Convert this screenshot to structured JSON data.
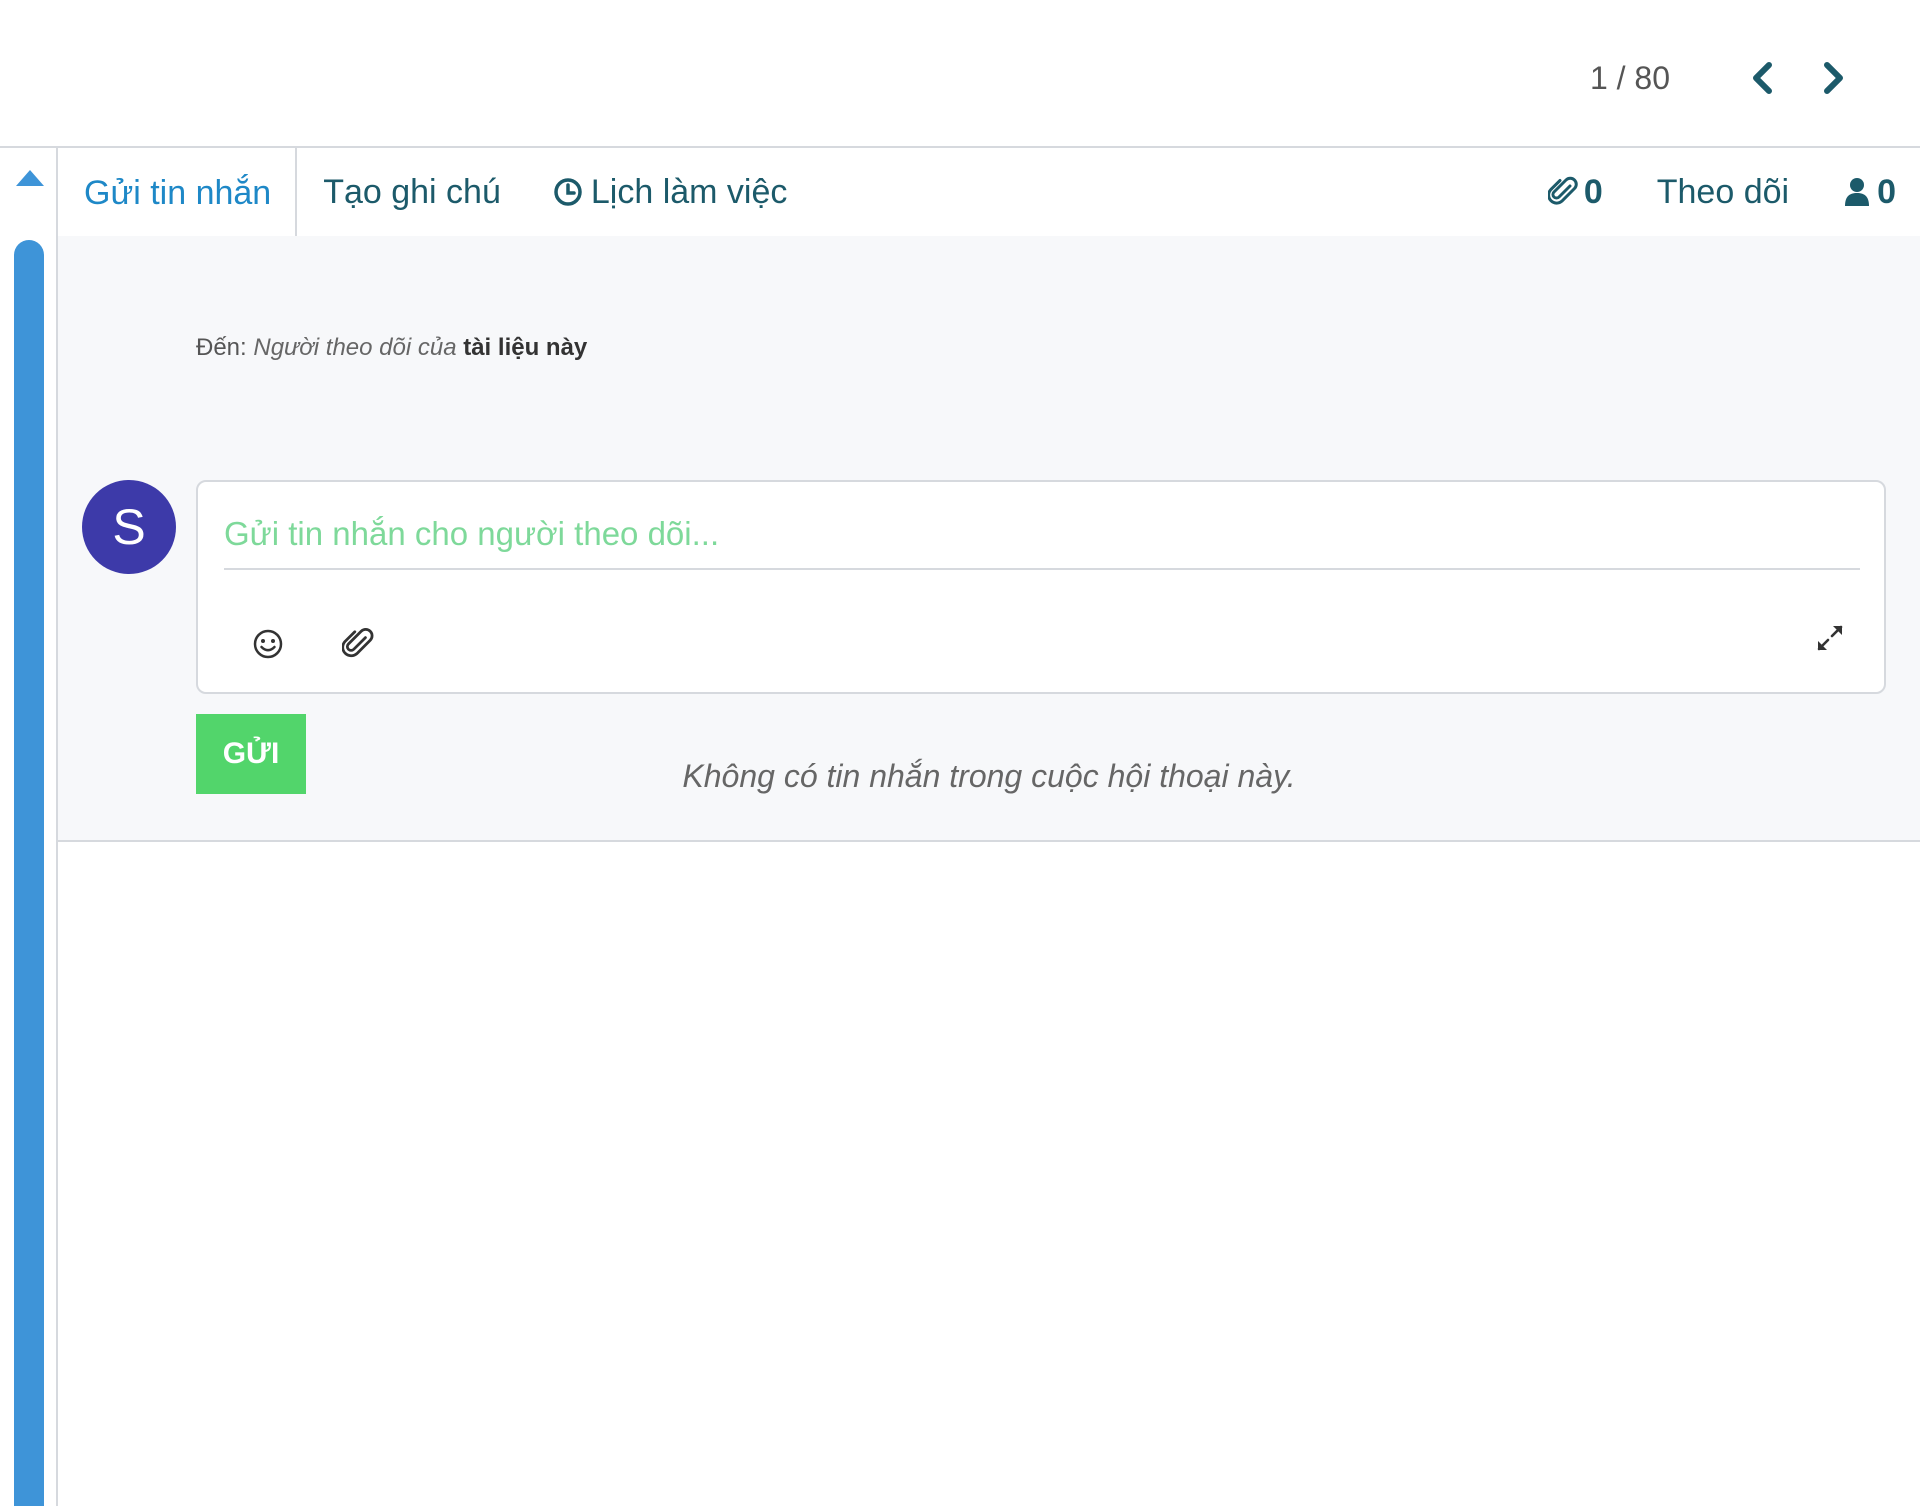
{
  "pager": {
    "value": "1 / 80",
    "prev_icon": "chevron-left-icon",
    "next_icon": "chevron-right-icon"
  },
  "tabs": {
    "send_message": "Gửi tin nhắn",
    "log_note": "Tạo ghi chú",
    "schedule_activity": "Lịch làm việc",
    "attachments_count": "0",
    "follow": "Theo dõi",
    "followers_count": "0"
  },
  "composer": {
    "to_label": "Đến:",
    "to_italic": "Người theo dõi của",
    "to_bold": "tài liệu này",
    "avatar_initial": "S",
    "placeholder": "Gửi tin nhắn cho người theo dõi...",
    "send_label": "GỬI"
  },
  "thread": {
    "empty_text": "Không có tin nhắn trong cuộc hội thoại này."
  },
  "colors": {
    "accent": "#1e88c7",
    "tab_text": "#1c5a6a",
    "send_green": "#52d56b",
    "avatar": "#3d3aa9",
    "scrollbar": "#3e94d8"
  }
}
